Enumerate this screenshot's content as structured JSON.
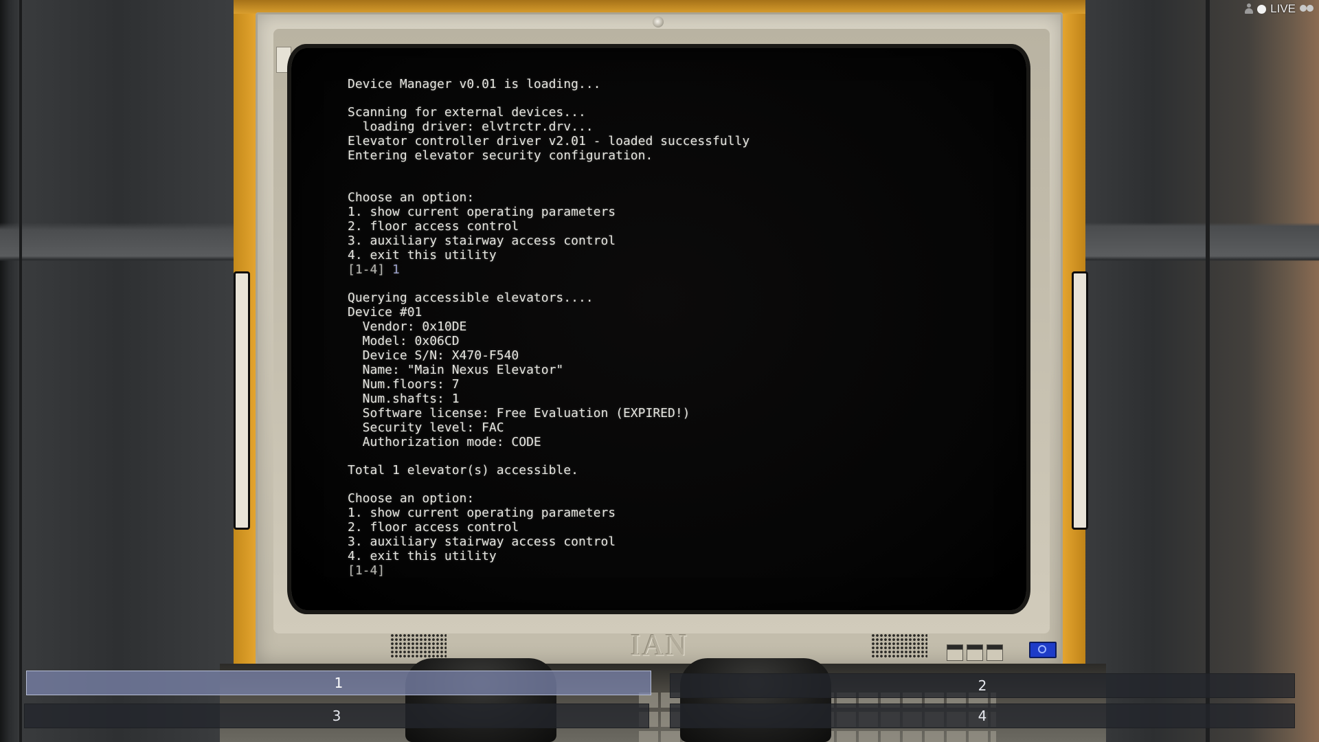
{
  "stream": {
    "live_label": "LIVE",
    "viewer_icon": "viewer-icon",
    "group_icon": "group-icon"
  },
  "monitor": {
    "brand": "IAN",
    "power_light_color": "#1e3cc8"
  },
  "terminal": {
    "lines": [
      "Device Manager v0.01 is loading...",
      "",
      "Scanning for external devices...",
      "  loading driver: elvtrctr.drv...",
      "Elevator controller driver v2.01 - loaded successfully",
      "Entering elevator security configuration.",
      "",
      "",
      "Choose an option:",
      "1. show current operating parameters",
      "2. floor access control",
      "3. auxiliary stairway access control",
      "4. exit this utility",
      "[1-4] 1",
      "",
      "Querying accessible elevators....",
      "Device #01",
      "  Vendor: 0x10DE",
      "  Model: 0x06CD",
      "  Device S/N: X470-F540",
      "  Name: \"Main Nexus Elevator\"",
      "  Num.floors: 7",
      "  Num.shafts: 1",
      "  Software license: Free Evaluation (EXPIRED!)",
      "  Security level: FAC",
      "  Authorization mode: CODE",
      "",
      "Total 1 elevator(s) accessible.",
      "",
      "Choose an option:",
      "1. show current operating parameters",
      "2. floor access control",
      "3. auxiliary stairway access control",
      "4. exit this utility",
      "[1-4]"
    ]
  },
  "choices": {
    "selected": "1",
    "options": [
      {
        "label": "1"
      },
      {
        "label": "2"
      },
      {
        "label": "3"
      },
      {
        "label": "4"
      }
    ]
  }
}
